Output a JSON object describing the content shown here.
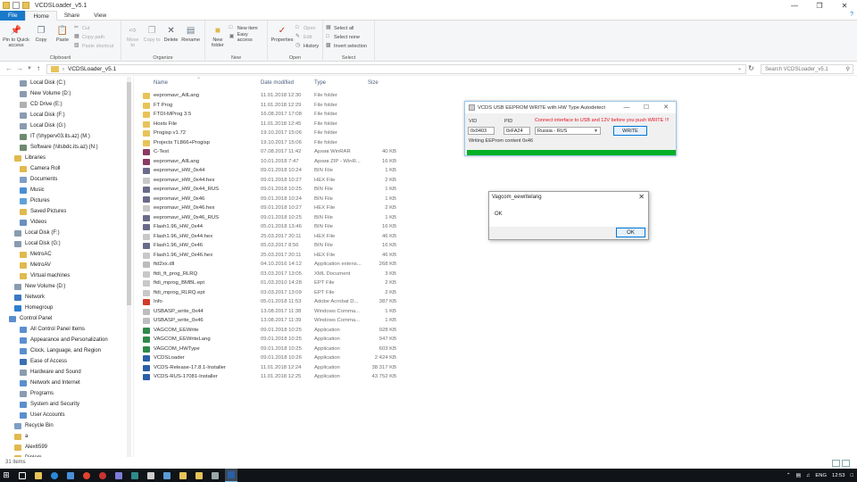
{
  "window": {
    "title": "VCDSLoader_v5.1"
  },
  "tabs": [
    "File",
    "Home",
    "Share",
    "View"
  ],
  "ribbon": {
    "clipboard": {
      "label": "Clipboard",
      "pin": "Pin to Quick access",
      "copy": "Copy",
      "paste": "Paste",
      "cut": "Cut",
      "copy_path": "Copy path",
      "paste_shortcut": "Paste shortcut"
    },
    "organize": {
      "label": "Organize",
      "move_to": "Move to",
      "copy_to": "Copy to",
      "delete": "Delete",
      "rename": "Rename"
    },
    "new": {
      "label": "New",
      "new_folder": "New folder",
      "new_item": "New item",
      "easy_access": "Easy access"
    },
    "open": {
      "label": "Open",
      "properties": "Properties",
      "open": "Open",
      "edit": "Edit",
      "history": "History"
    },
    "select": {
      "label": "Select",
      "select_all": "Select all",
      "select_none": "Select none",
      "invert": "Invert selection"
    }
  },
  "address": {
    "path": "VCDSLoader_v5.1",
    "search_placeholder": "Search VCDSLoader_v5.1"
  },
  "nav": [
    {
      "label": "Local Disk (C:)",
      "indent": 22,
      "color": "#8a9bb0"
    },
    {
      "label": "New Volume (D:)",
      "indent": 22,
      "color": "#8a9bb0"
    },
    {
      "label": "CD Drive (E:)",
      "indent": 22,
      "color": "#b0b0b0"
    },
    {
      "label": "Local Disk (F:)",
      "indent": 22,
      "color": "#8a9bb0"
    },
    {
      "label": "Local Disk (G:)",
      "indent": 22,
      "color": "#8a9bb0"
    },
    {
      "label": "IT (\\\\hyperv03.its.az) (M:)",
      "indent": 22,
      "color": "#6f8a6f"
    },
    {
      "label": "Software (\\\\itsbdc.its.az) (N:)",
      "indent": 22,
      "color": "#6f8a6f"
    },
    {
      "label": "Libraries",
      "indent": 16,
      "color": "#e0b94f"
    },
    {
      "label": "Camera Roll",
      "indent": 22,
      "color": "#e0b94f"
    },
    {
      "label": "Documents",
      "indent": 22,
      "color": "#7d9fc7"
    },
    {
      "label": "Music",
      "indent": 22,
      "color": "#4a8fd4"
    },
    {
      "label": "Pictures",
      "indent": 22,
      "color": "#5fa0d8"
    },
    {
      "label": "Saved Pictures",
      "indent": 22,
      "color": "#e0b94f"
    },
    {
      "label": "Videos",
      "indent": 22,
      "color": "#6a8fc0"
    },
    {
      "label": "Local Disk (F:)",
      "indent": 16,
      "color": "#8a9bb0"
    },
    {
      "label": "Local Disk (G:)",
      "indent": 16,
      "color": "#8a9bb0"
    },
    {
      "label": "MetroAC",
      "indent": 22,
      "color": "#e0b94f"
    },
    {
      "label": "MetroAV",
      "indent": 22,
      "color": "#e0b94f"
    },
    {
      "label": "Virtual machines",
      "indent": 22,
      "color": "#e0b94f"
    },
    {
      "label": "New Volume (D:)",
      "indent": 16,
      "color": "#8a9bb0"
    },
    {
      "label": "Network",
      "indent": 16,
      "color": "#3b78c2"
    },
    {
      "label": "Homegroup",
      "indent": 16,
      "color": "#2d7fd1"
    },
    {
      "label": "Control Panel",
      "indent": 10,
      "color": "#5a8fcf"
    },
    {
      "label": "All Control Panel Items",
      "indent": 22,
      "color": "#5a8fcf"
    },
    {
      "label": "Appearance and Personalization",
      "indent": 22,
      "color": "#5a8fcf"
    },
    {
      "label": "Clock, Language, and Region",
      "indent": 22,
      "color": "#5a8fcf"
    },
    {
      "label": "Ease of Access",
      "indent": 22,
      "color": "#3b6fb6"
    },
    {
      "label": "Hardware and Sound",
      "indent": 22,
      "color": "#8a9bb0"
    },
    {
      "label": "Network and Internet",
      "indent": 22,
      "color": "#5a8fcf"
    },
    {
      "label": "Programs",
      "indent": 22,
      "color": "#8a9bb0"
    },
    {
      "label": "System and Security",
      "indent": 22,
      "color": "#5a8fcf"
    },
    {
      "label": "User Accounts",
      "indent": 22,
      "color": "#5a8fcf"
    },
    {
      "label": "Recycle Bin",
      "indent": 16,
      "color": "#7d9fc7"
    },
    {
      "label": "a",
      "indent": 16,
      "color": "#e0b94f"
    },
    {
      "label": "Alex6599",
      "indent": 16,
      "color": "#e0b94f"
    },
    {
      "label": "Diplom",
      "indent": 16,
      "color": "#e0b94f"
    }
  ],
  "columns": {
    "name": "Name",
    "date": "Date modified",
    "type": "Type",
    "size": "Size"
  },
  "files": [
    {
      "name": "eepromavr_AllLang",
      "date": "11.01.2018 12:30",
      "type": "File folder",
      "size": "",
      "color": "#e8c35a"
    },
    {
      "name": "FT Prog",
      "date": "11.01.2018 12:29",
      "type": "File folder",
      "size": "",
      "color": "#e8c35a"
    },
    {
      "name": "FTDI-MProg 3.5",
      "date": "16.08.2017 17:08",
      "type": "File folder",
      "size": "",
      "color": "#e8c35a"
    },
    {
      "name": "Hosts File",
      "date": "11.01.2018 12:45",
      "type": "File folder",
      "size": "",
      "color": "#e8c35a"
    },
    {
      "name": "Progisp v1.72",
      "date": "19.10.2017 15:06",
      "type": "File folder",
      "size": "",
      "color": "#e8c35a"
    },
    {
      "name": "Projects TL866+Progisp",
      "date": "19.10.2017 15:06",
      "type": "File folder",
      "size": "",
      "color": "#e8c35a"
    },
    {
      "name": "C-Test",
      "date": "07.08.2017 11:42",
      "type": "Архив WinRAR",
      "size": "40 KB",
      "color": "#8b3a62"
    },
    {
      "name": "eepromavr_AllLang",
      "date": "10.01.2018 7:47",
      "type": "Архив ZIP - WinR...",
      "size": "16 KB",
      "color": "#8b3a62"
    },
    {
      "name": "eepromavr_HW_0x44",
      "date": "09.01.2018 10:24",
      "type": "BIN File",
      "size": "1 KB",
      "color": "#6a6a8a"
    },
    {
      "name": "eepromavr_HW_0x44.hex",
      "date": "09.01.2018 10:27",
      "type": "HEX File",
      "size": "2 KB",
      "color": "#c8c8c8"
    },
    {
      "name": "eepromavr_HW_0x44_RUS",
      "date": "09.01.2018 10:25",
      "type": "BIN File",
      "size": "1 KB",
      "color": "#6a6a8a"
    },
    {
      "name": "eepromavr_HW_0x46",
      "date": "09.01.2018 10:24",
      "type": "BIN File",
      "size": "1 KB",
      "color": "#6a6a8a"
    },
    {
      "name": "eepromavr_HW_0x46.hex",
      "date": "09.01.2018 10:27",
      "type": "HEX File",
      "size": "2 KB",
      "color": "#c8c8c8"
    },
    {
      "name": "eepromavr_HW_0x46_RUS",
      "date": "09.01.2018 10:25",
      "type": "BIN File",
      "size": "1 KB",
      "color": "#6a6a8a"
    },
    {
      "name": "Flash1.96_HW_0x44",
      "date": "05.01.2018 13:46",
      "type": "BIN File",
      "size": "16 KB",
      "color": "#6a6a8a"
    },
    {
      "name": "Flash1.96_HW_0x44.hex",
      "date": "25.03.2017 20:11",
      "type": "HEX File",
      "size": "46 KB",
      "color": "#c8c8c8"
    },
    {
      "name": "Flash1.96_HW_0x46",
      "date": "05.03.2017 8:56",
      "type": "BIN File",
      "size": "16 KB",
      "color": "#6a6a8a"
    },
    {
      "name": "Flash1.96_HW_0x46.hex",
      "date": "25.03.2017 20:11",
      "type": "HEX File",
      "size": "46 KB",
      "color": "#c8c8c8"
    },
    {
      "name": "ftd2xx.dll",
      "date": "04.10.2016 14:12",
      "type": "Application extens...",
      "size": "268 KB",
      "color": "#bdbdbd"
    },
    {
      "name": "ftdi_ft_prog_RLRQ",
      "date": "03.03.2017 13:05",
      "type": "XML Document",
      "size": "3 KB",
      "color": "#c8c8c8"
    },
    {
      "name": "ftdi_mprog_BMBL.ept",
      "date": "01.03.2010 14:28",
      "type": "EPT File",
      "size": "2 KB",
      "color": "#c8c8c8"
    },
    {
      "name": "ftdi_mprog_RLRQ.ept",
      "date": "03.03.2017 13:09",
      "type": "EPT File",
      "size": "2 KB",
      "color": "#c8c8c8"
    },
    {
      "name": "Info",
      "date": "05.01.2018 11:53",
      "type": "Adobe Acrobat D...",
      "size": "387 KB",
      "color": "#d23a2a"
    },
    {
      "name": "USBASP_write_0x44",
      "date": "13.08.2017 11:38",
      "type": "Windows Comma...",
      "size": "1 KB",
      "color": "#bdbdbd"
    },
    {
      "name": "USBASP_write_0x46",
      "date": "13.08.2017 11:39",
      "type": "Windows Comma...",
      "size": "1 KB",
      "color": "#bdbdbd"
    },
    {
      "name": "VAGCOM_EEWrite",
      "date": "09.01.2018 10:25",
      "type": "Application",
      "size": "928 KB",
      "color": "#2f8a4a"
    },
    {
      "name": "VAGCOM_EEWriteLang",
      "date": "09.01.2018 10:25",
      "type": "Application",
      "size": "947 KB",
      "color": "#2f8a4a"
    },
    {
      "name": "VAGCOM_HWType",
      "date": "09.01.2018 10:25",
      "type": "Application",
      "size": "603 KB",
      "color": "#2f8a4a"
    },
    {
      "name": "VCDSLoader",
      "date": "09.01.2018 10:26",
      "type": "Application",
      "size": "2 424 KB",
      "color": "#2b5fa8"
    },
    {
      "name": "VCDS-Release-17.8.1-Installer",
      "date": "11.01.2018 12:24",
      "type": "Application",
      "size": "38 317 KB",
      "color": "#2b5fa8"
    },
    {
      "name": "VCDS-RUS-17081-Installer",
      "date": "11.01.2018 12:25",
      "type": "Application",
      "size": "43 752 KB",
      "color": "#2b5fa8"
    }
  ],
  "status": {
    "items": "31 items"
  },
  "vcds": {
    "title": "VCDS USB EEPROM WRITE with HW Type Autodetect",
    "vid_label": "VID",
    "vid_value": "0x0403",
    "pid_label": "PID",
    "pid_value": "0xFA24",
    "warning": "Connect interface to USB and 12V before you push WRITE !!!",
    "language": "Russia - RUS",
    "write_button": "WRITE",
    "status_text": "Writing EEProm content 0x46",
    "progress": 1.0,
    "progress_color": "#06b025"
  },
  "dialog": {
    "title": "Vagcom_eewritelang",
    "message": "OK",
    "ok_button": "OK"
  },
  "taskbar": {
    "language": "ENG",
    "time": "12:53"
  }
}
